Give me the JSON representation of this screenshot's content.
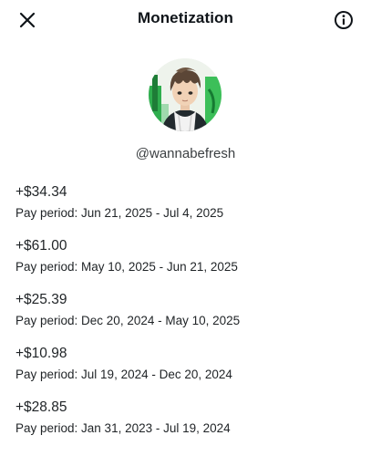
{
  "header": {
    "title": "Monetization",
    "close_icon": "close-icon",
    "info_icon": "info-icon"
  },
  "profile": {
    "handle": "@wannabefresh",
    "accent_color": "#2fae4e"
  },
  "payouts": [
    {
      "amount": "+$34.34",
      "period": "Pay period: Jun 21, 2025 - Jul 4, 2025"
    },
    {
      "amount": "+$61.00",
      "period": "Pay period: May 10, 2025 - Jun 21, 2025"
    },
    {
      "amount": "+$25.39",
      "period": "Pay period: Dec 20, 2024 - May 10, 2025"
    },
    {
      "amount": "+$10.98",
      "period": "Pay period: Jul 19, 2024 - Dec 20, 2024"
    },
    {
      "amount": "+$28.85",
      "period": "Pay period: Jan 31, 2023 - Jul 19, 2024"
    }
  ]
}
